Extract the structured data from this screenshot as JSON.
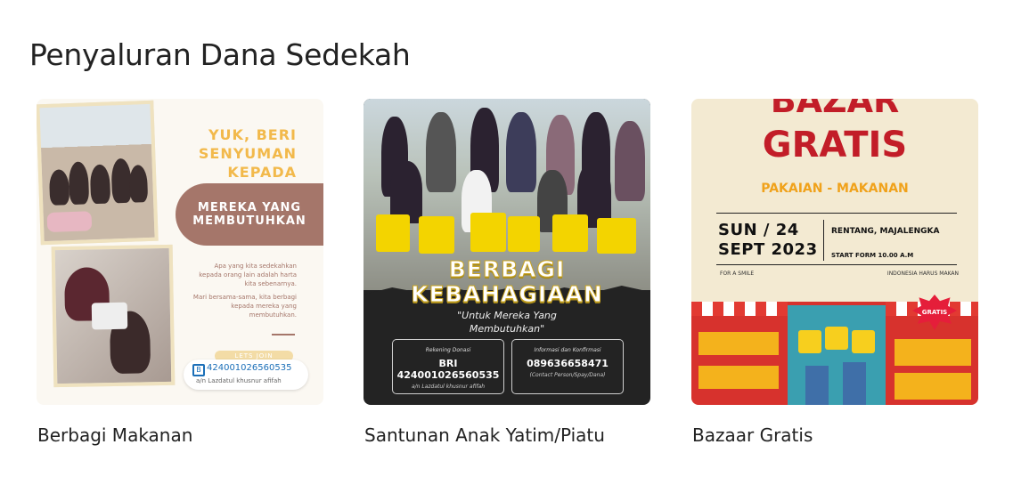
{
  "page": {
    "title": "Penyaluran Dana Sedekah"
  },
  "cards": [
    {
      "title": "Berbagi Makanan",
      "poster": {
        "heading": [
          "YUK, BERI",
          "SENYUMAN",
          "KEPADA"
        ],
        "pill": [
          "MEREKA YANG",
          "MEMBUTUHKAN"
        ],
        "small_1": "Apa yang kita sedekahkan kepada orang lain adalah harta kita sebenarnya.",
        "small_2": "Mari bersama-sama, kita berbagi kepada mereka yang membutuhkan.",
        "join": "LETS JOIN",
        "account_number": "424001026560535",
        "account_name": "a/n Lazdatul khusnur afifah",
        "bank_icon": "bank-logo-icon"
      }
    },
    {
      "title": "Santunan Anak Yatim/Piatu",
      "poster": {
        "big_1": "BERBAGI",
        "big_2": "KEBAHAGIAAN",
        "quote": [
          "\"Untuk Mereka Yang",
          "Membutuhkan\""
        ],
        "box_left": {
          "label": "Rekening Donasi",
          "value": "BRI 424001026560535",
          "sub": "a/n Lazdatul khusnur afifah"
        },
        "box_right": {
          "label": "Informasi dan Konfirmasi",
          "value": "089636658471",
          "sub": "(Contact Person/Spay/Dana)"
        }
      }
    },
    {
      "title": "Bazaar Gratis",
      "poster": {
        "bazar": "BAZAR",
        "gratis": "GRATIS",
        "sub": "PAKAIAN - MAKANAN",
        "date": [
          "SUN / 24",
          "SEPT 2023"
        ],
        "place": "RENTANG, MAJALENGKA",
        "start": "START FORM 10.00 A.M",
        "tiny_left": "FOR A SMILE",
        "tiny_right": "INDONESIA HARUS MAKAN",
        "burst": "GRATIS"
      }
    }
  ]
}
